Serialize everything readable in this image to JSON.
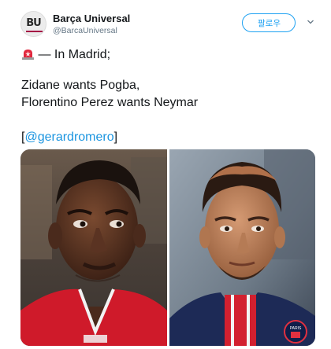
{
  "tweet": {
    "author": {
      "display_name": "Barça Universal",
      "handle": "@BarcaUniversal",
      "avatar_text": "BU"
    },
    "follow_label": "팔로우",
    "text": {
      "line1_rest": "—  In Madrid;",
      "line2": "Zidane wants Pogba,",
      "line3": "Florentino Perez wants Neymar",
      "line4_open": "[",
      "mention": "@gerardromero",
      "line4_close": "]"
    },
    "icons": {
      "siren": "police-light-emoji",
      "caret": "chevron-down-icon"
    },
    "media": {
      "count": 2,
      "colors": {
        "united_red": "#cf1a2a",
        "psg_navy": "#1d2a56"
      }
    }
  }
}
